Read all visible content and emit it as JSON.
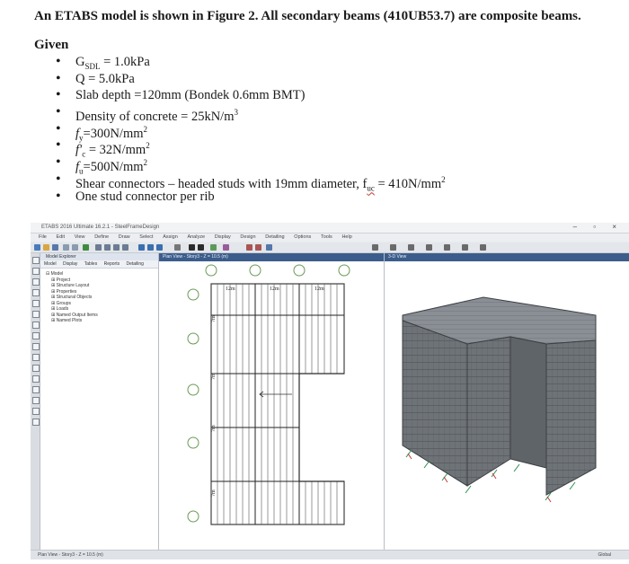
{
  "problem": {
    "title": "An ETABS model is shown in Figure 2. All secondary beams (410UB53.7) are composite beams.",
    "given_label": "Given",
    "items": [
      {
        "main": "G",
        "sub": "SDL",
        "rest": " = 1.0kPa"
      },
      {
        "main": "Q = 5.0kPa"
      },
      {
        "main": "Slab depth =120mm (Bondek 0.6mm BMT)"
      },
      {
        "main": "Density of concrete = 25kN/m",
        "sup": "3"
      },
      {
        "main": "f",
        "sub": "y",
        "rest": "=300N/mm",
        "sup": "2"
      },
      {
        "main": "f′",
        "sub": "c",
        "rest": " = 32N/mm",
        "sup": "2"
      },
      {
        "main": "f",
        "sub": "u",
        "rest": "=500N/mm",
        "sup": "2"
      },
      {
        "main": "Shear connectors – headed studs with 19mm diameter, f",
        "sub": "uc",
        "rest": " = 410N/mm",
        "sup": "2"
      },
      {
        "main": "One stud connector per rib"
      }
    ]
  },
  "app": {
    "title": "ETABS 2016 Ultimate 16.2.1 - SteelFrameDesign",
    "menu": [
      "File",
      "Edit",
      "View",
      "Define",
      "Draw",
      "Select",
      "Assign",
      "Analyze",
      "Display",
      "Design",
      "Detailing",
      "Options",
      "Tools",
      "Help"
    ],
    "explorer": {
      "header": "Model Explorer",
      "tabs": [
        "Model",
        "Display",
        "Tables",
        "Reports",
        "Detailing"
      ],
      "tree": [
        "Model",
        "Project",
        "Structure Layout",
        "Properties",
        "Structural Objects",
        "Groups",
        "Loads",
        "Named Output Items",
        "Named Plots"
      ]
    },
    "plan_view": {
      "header": "Plan View - Story3 - Z = 10.5 (m)",
      "spans": [
        "12m",
        "12m",
        "12m"
      ],
      "bays": [
        "7m",
        "7m",
        "7m",
        "7m"
      ]
    },
    "view3d": {
      "header": "3-D View"
    },
    "status": {
      "left": "Plan View - Story3 - Z = 10.5 (m)",
      "right": "Global"
    }
  },
  "colors": {
    "grid_bubble": "#6a9a55",
    "title_bar": "#3c5d8c",
    "building": "#6b6f74"
  }
}
